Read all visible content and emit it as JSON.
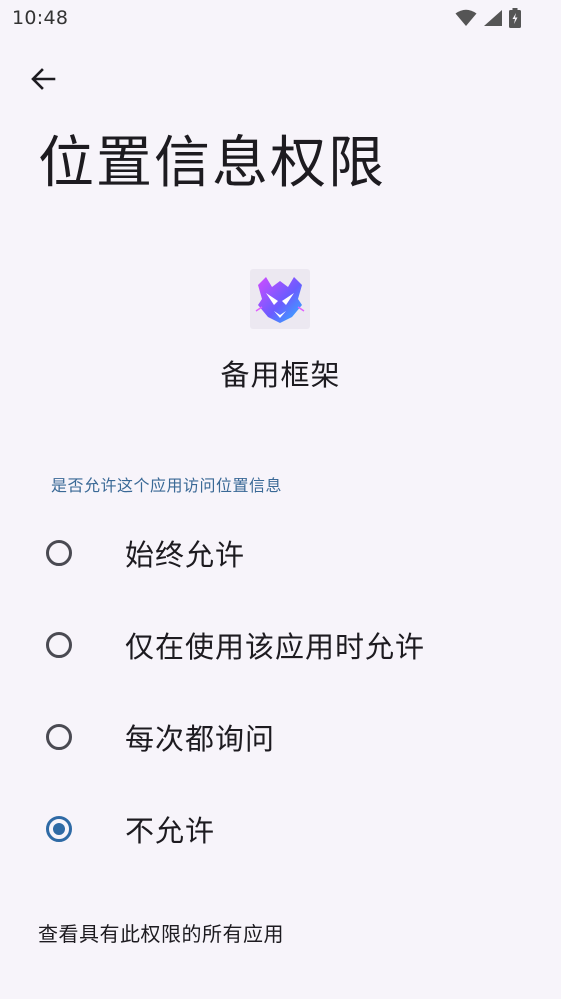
{
  "status_bar": {
    "time": "10:48",
    "icons": [
      "wifi-icon",
      "cellular-signal-icon",
      "battery-charging-icon"
    ]
  },
  "header": {
    "back_icon": "arrow-back-icon",
    "title": "位置信息权限"
  },
  "app": {
    "icon": "app-icon",
    "name": "备用框架"
  },
  "permission": {
    "question": "是否允许这个应用访问位置信息",
    "options": [
      {
        "label": "始终允许",
        "selected": false
      },
      {
        "label": "仅在使用该应用时允许",
        "selected": false
      },
      {
        "label": "每次都询问",
        "selected": false
      },
      {
        "label": "不允许",
        "selected": true
      }
    ]
  },
  "footer": {
    "link": "查看具有此权限的所有应用"
  },
  "colors": {
    "background": "#f7f4fa",
    "accent": "#2e6aa5",
    "section_header": "#3a6996",
    "text": "#1d1b20"
  }
}
